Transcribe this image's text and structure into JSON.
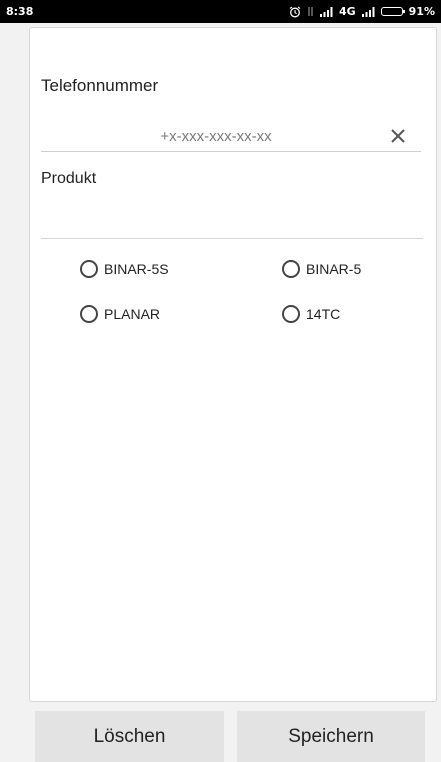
{
  "status_bar": {
    "time": "8:38",
    "network": "4G",
    "battery": "91%",
    "battery_level": 0.91,
    "icons": [
      "alarm-icon",
      "data-arrows-icon",
      "signal-icon",
      "signal-icon-2",
      "battery-icon"
    ]
  },
  "form": {
    "phone": {
      "label": "Telefonnummer",
      "placeholder": "+x-xxx-xxx-xx-xx",
      "value": ""
    },
    "product": {
      "label": "Produkt",
      "options": [
        "BINAR-5S",
        "BINAR-5",
        "PLANAR",
        "14TC"
      ],
      "selected": null
    }
  },
  "buttons": {
    "delete_label": "Löschen",
    "save_label": "Speichern"
  },
  "colors": {
    "background": "#f2f2f2",
    "card": "#ffffff",
    "button": "#e3e3e3",
    "status_bar": "#000000"
  }
}
